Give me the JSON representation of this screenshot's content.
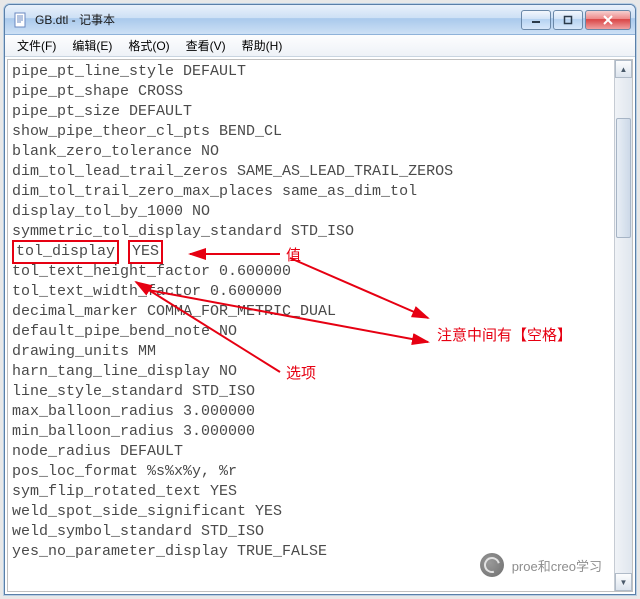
{
  "window": {
    "title": "GB.dtl - 记事本"
  },
  "menu": {
    "file": "文件(F)",
    "edit": "编辑(E)",
    "format": "格式(O)",
    "view": "查看(V)",
    "help": "帮助(H)"
  },
  "lines": [
    "pipe_pt_line_style DEFAULT",
    "pipe_pt_shape CROSS",
    "pipe_pt_size DEFAULT",
    "show_pipe_theor_cl_pts BEND_CL",
    "blank_zero_tolerance NO",
    "dim_tol_lead_trail_zeros SAME_AS_LEAD_TRAIL_ZEROS",
    "dim_tol_trail_zero_max_places same_as_dim_tol",
    "display_tol_by_1000 NO",
    "symmetric_tol_display_standard STD_ISO",
    "",
    "tol_text_height_factor 0.600000",
    "tol_text_width_factor 0.600000",
    "decimal_marker COMMA_FOR_METRIC_DUAL",
    "default_pipe_bend_note NO",
    "drawing_units MM",
    "harn_tang_line_display NO",
    "line_style_standard STD_ISO",
    "max_balloon_radius 3.000000",
    "min_balloon_radius 3.000000",
    "node_radius DEFAULT",
    "pos_loc_format %s%x%y, %r",
    "sym_flip_rotated_text YES",
    "weld_spot_side_significant YES",
    "weld_symbol_standard STD_ISO",
    "yes_no_parameter_display TRUE_FALSE"
  ],
  "highlighted_line": {
    "key": "tol_display",
    "value": "YES"
  },
  "annotations": {
    "value_label": "值",
    "option_label": "选项",
    "note": "注意中间有【空格】"
  },
  "watermark": "proe和creo学习"
}
